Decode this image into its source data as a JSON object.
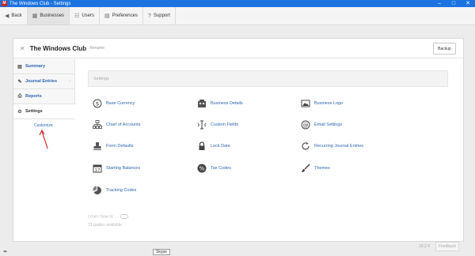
{
  "window": {
    "title": "The Windows Club - Settings",
    "app_icon": "M"
  },
  "toolbar": {
    "back_label": "Back",
    "businesses_label": "Businesses",
    "users_label": "Users",
    "preferences_label": "Preferences",
    "support_label": "Support"
  },
  "header": {
    "business_name": "The Windows Club",
    "rename_label": "Rename",
    "backup_label": "Backup"
  },
  "sidebar": {
    "items": [
      {
        "label": "Summary"
      },
      {
        "label": "Journal Entries"
      },
      {
        "label": "Reports"
      },
      {
        "label": "Settings"
      }
    ],
    "customize_label": "Customize"
  },
  "settings": {
    "title": "Settings",
    "items": [
      {
        "label": "Base Currency",
        "icon": "currency-icon"
      },
      {
        "label": "Business Details",
        "icon": "building-icon"
      },
      {
        "label": "Business Logo",
        "icon": "image-icon"
      },
      {
        "label": "Chart of Accounts",
        "icon": "org-chart-icon"
      },
      {
        "label": "Custom Fields",
        "icon": "text-cursor-icon"
      },
      {
        "label": "Email Settings",
        "icon": "at-icon"
      },
      {
        "label": "Form Defaults",
        "icon": "stamp-icon"
      },
      {
        "label": "Lock Date",
        "icon": "lock-icon"
      },
      {
        "label": "Recurring Journal Entries",
        "icon": "refresh-icon"
      },
      {
        "label": "Starting Balances",
        "icon": "calendar-icon"
      },
      {
        "label": "Tax Codes",
        "icon": "percent-icon"
      },
      {
        "label": "Themes",
        "icon": "brush-icon"
      },
      {
        "label": "Tracking Codes",
        "icon": "pie-chart-icon"
      }
    ]
  },
  "learn": {
    "label": "Learn how to ...",
    "guides_label": "21 guides available"
  },
  "footer": {
    "version": "19.2.4",
    "feedback_label": "Feedback",
    "tooltip": "Skype"
  },
  "colors": {
    "titlebar": "#1a73e0",
    "link": "#2a66b0",
    "app_icon": "#c62828"
  }
}
